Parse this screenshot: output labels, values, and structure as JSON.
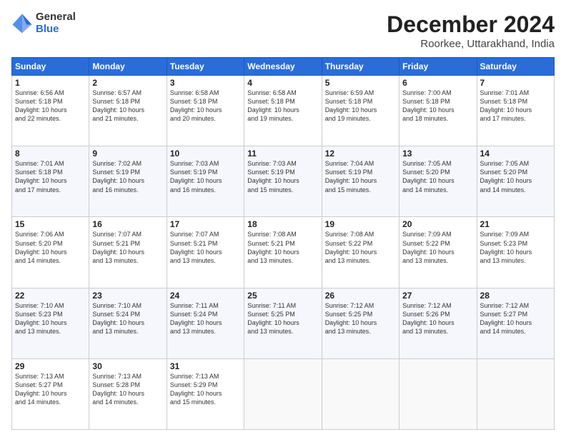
{
  "header": {
    "logo_general": "General",
    "logo_blue": "Blue",
    "month_title": "December 2024",
    "location": "Roorkee, Uttarakhand, India"
  },
  "days_of_week": [
    "Sunday",
    "Monday",
    "Tuesday",
    "Wednesday",
    "Thursday",
    "Friday",
    "Saturday"
  ],
  "weeks": [
    [
      {
        "day": "1",
        "info": "Sunrise: 6:56 AM\nSunset: 5:18 PM\nDaylight: 10 hours\nand 22 minutes."
      },
      {
        "day": "2",
        "info": "Sunrise: 6:57 AM\nSunset: 5:18 PM\nDaylight: 10 hours\nand 21 minutes."
      },
      {
        "day": "3",
        "info": "Sunrise: 6:58 AM\nSunset: 5:18 PM\nDaylight: 10 hours\nand 20 minutes."
      },
      {
        "day": "4",
        "info": "Sunrise: 6:58 AM\nSunset: 5:18 PM\nDaylight: 10 hours\nand 19 minutes."
      },
      {
        "day": "5",
        "info": "Sunrise: 6:59 AM\nSunset: 5:18 PM\nDaylight: 10 hours\nand 19 minutes."
      },
      {
        "day": "6",
        "info": "Sunrise: 7:00 AM\nSunset: 5:18 PM\nDaylight: 10 hours\nand 18 minutes."
      },
      {
        "day": "7",
        "info": "Sunrise: 7:01 AM\nSunset: 5:18 PM\nDaylight: 10 hours\nand 17 minutes."
      }
    ],
    [
      {
        "day": "8",
        "info": "Sunrise: 7:01 AM\nSunset: 5:18 PM\nDaylight: 10 hours\nand 17 minutes."
      },
      {
        "day": "9",
        "info": "Sunrise: 7:02 AM\nSunset: 5:19 PM\nDaylight: 10 hours\nand 16 minutes."
      },
      {
        "day": "10",
        "info": "Sunrise: 7:03 AM\nSunset: 5:19 PM\nDaylight: 10 hours\nand 16 minutes."
      },
      {
        "day": "11",
        "info": "Sunrise: 7:03 AM\nSunset: 5:19 PM\nDaylight: 10 hours\nand 15 minutes."
      },
      {
        "day": "12",
        "info": "Sunrise: 7:04 AM\nSunset: 5:19 PM\nDaylight: 10 hours\nand 15 minutes."
      },
      {
        "day": "13",
        "info": "Sunrise: 7:05 AM\nSunset: 5:20 PM\nDaylight: 10 hours\nand 14 minutes."
      },
      {
        "day": "14",
        "info": "Sunrise: 7:05 AM\nSunset: 5:20 PM\nDaylight: 10 hours\nand 14 minutes."
      }
    ],
    [
      {
        "day": "15",
        "info": "Sunrise: 7:06 AM\nSunset: 5:20 PM\nDaylight: 10 hours\nand 14 minutes."
      },
      {
        "day": "16",
        "info": "Sunrise: 7:07 AM\nSunset: 5:21 PM\nDaylight: 10 hours\nand 13 minutes."
      },
      {
        "day": "17",
        "info": "Sunrise: 7:07 AM\nSunset: 5:21 PM\nDaylight: 10 hours\nand 13 minutes."
      },
      {
        "day": "18",
        "info": "Sunrise: 7:08 AM\nSunset: 5:21 PM\nDaylight: 10 hours\nand 13 minutes."
      },
      {
        "day": "19",
        "info": "Sunrise: 7:08 AM\nSunset: 5:22 PM\nDaylight: 10 hours\nand 13 minutes."
      },
      {
        "day": "20",
        "info": "Sunrise: 7:09 AM\nSunset: 5:22 PM\nDaylight: 10 hours\nand 13 minutes."
      },
      {
        "day": "21",
        "info": "Sunrise: 7:09 AM\nSunset: 5:23 PM\nDaylight: 10 hours\nand 13 minutes."
      }
    ],
    [
      {
        "day": "22",
        "info": "Sunrise: 7:10 AM\nSunset: 5:23 PM\nDaylight: 10 hours\nand 13 minutes."
      },
      {
        "day": "23",
        "info": "Sunrise: 7:10 AM\nSunset: 5:24 PM\nDaylight: 10 hours\nand 13 minutes."
      },
      {
        "day": "24",
        "info": "Sunrise: 7:11 AM\nSunset: 5:24 PM\nDaylight: 10 hours\nand 13 minutes."
      },
      {
        "day": "25",
        "info": "Sunrise: 7:11 AM\nSunset: 5:25 PM\nDaylight: 10 hours\nand 13 minutes."
      },
      {
        "day": "26",
        "info": "Sunrise: 7:12 AM\nSunset: 5:25 PM\nDaylight: 10 hours\nand 13 minutes."
      },
      {
        "day": "27",
        "info": "Sunrise: 7:12 AM\nSunset: 5:26 PM\nDaylight: 10 hours\nand 13 minutes."
      },
      {
        "day": "28",
        "info": "Sunrise: 7:12 AM\nSunset: 5:27 PM\nDaylight: 10 hours\nand 14 minutes."
      }
    ],
    [
      {
        "day": "29",
        "info": "Sunrise: 7:13 AM\nSunset: 5:27 PM\nDaylight: 10 hours\nand 14 minutes."
      },
      {
        "day": "30",
        "info": "Sunrise: 7:13 AM\nSunset: 5:28 PM\nDaylight: 10 hours\nand 14 minutes."
      },
      {
        "day": "31",
        "info": "Sunrise: 7:13 AM\nSunset: 5:29 PM\nDaylight: 10 hours\nand 15 minutes."
      },
      {
        "day": "",
        "info": ""
      },
      {
        "day": "",
        "info": ""
      },
      {
        "day": "",
        "info": ""
      },
      {
        "day": "",
        "info": ""
      }
    ]
  ]
}
